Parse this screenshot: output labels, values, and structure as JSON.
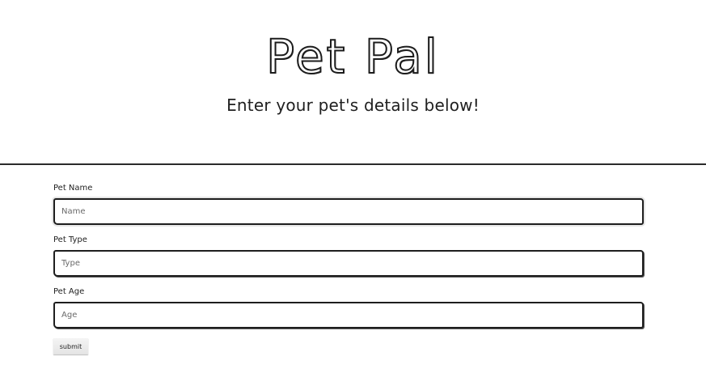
{
  "header": {
    "title": "Pet Pal",
    "subtitle": "Enter your pet's details below!"
  },
  "form": {
    "fields": [
      {
        "label": "Pet Name",
        "placeholder": "Name",
        "value": ""
      },
      {
        "label": "Pet Type",
        "placeholder": "Type",
        "value": ""
      },
      {
        "label": "Pet Age",
        "placeholder": "Age",
        "value": ""
      }
    ],
    "submit_label": "submit"
  }
}
